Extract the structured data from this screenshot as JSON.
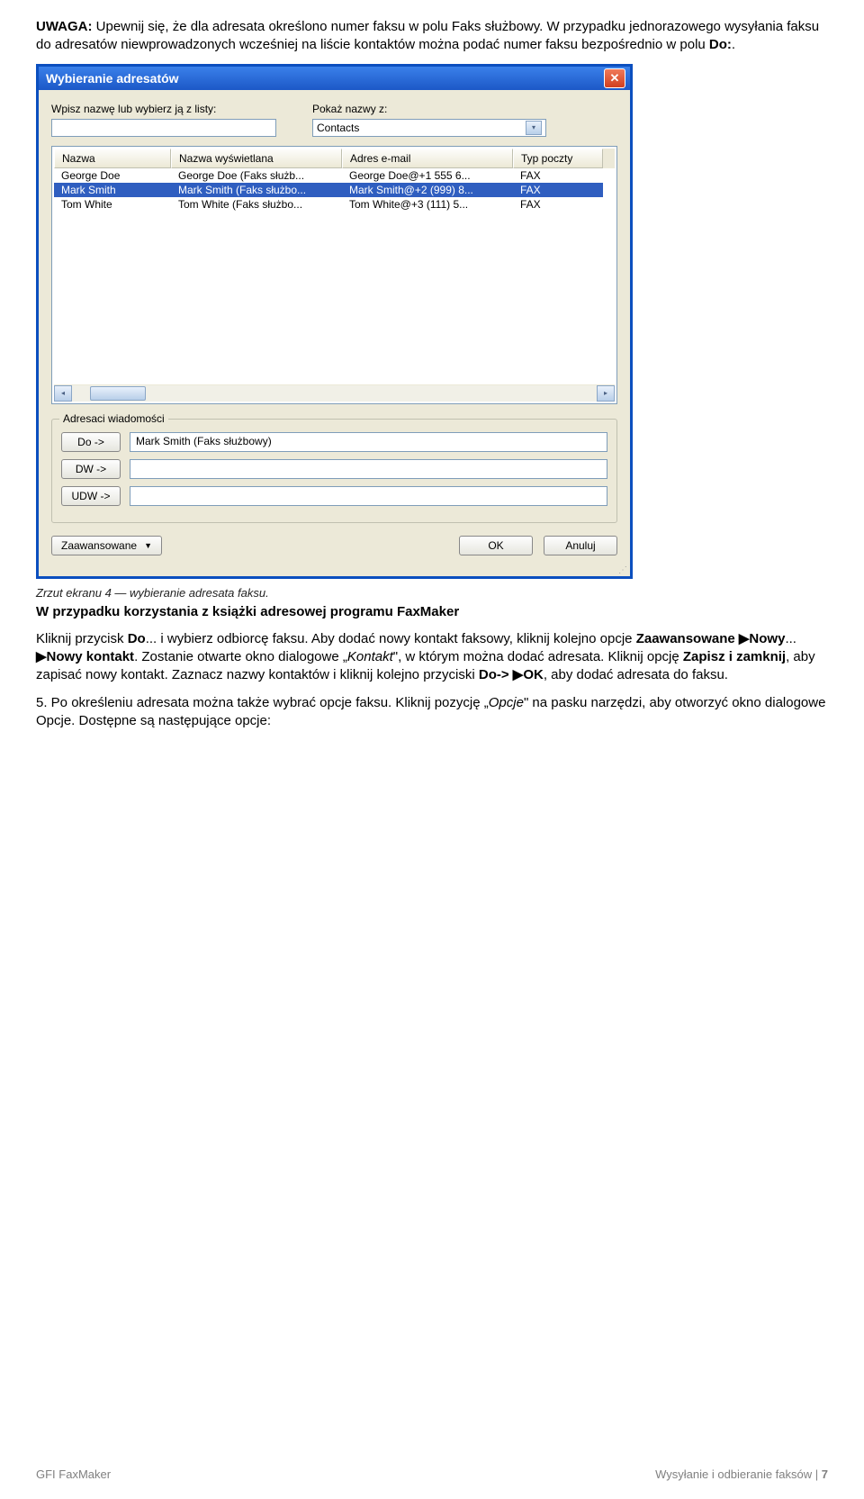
{
  "para1_prefix": "UWAGA:",
  "para1_body": " Upewnij się, że dla adresata określono numer faksu w polu Faks służbowy. W przypadku jednorazowego wysyłania faksu do adresatów niewprowadzonych wcześniej na liście kontaktów można podać numer faksu bezpośrednio w polu ",
  "para1_bold2": "Do:",
  "para1_tail": ".",
  "dialog": {
    "title": "Wybieranie adresatów",
    "label_name": "Wpisz nazwę lub wybierz ją z listy:",
    "label_show": "Pokaż nazwy z:",
    "combo_value": "Contacts",
    "columns": {
      "nazwa": "Nazwa",
      "wys": "Nazwa wyświetlana",
      "email": "Adres e-mail",
      "typ": "Typ poczty"
    },
    "rows": [
      {
        "nazwa": "George Doe",
        "wys": "George Doe (Faks służb...",
        "email": "George Doe@+1 555 6...",
        "typ": "FAX",
        "selected": false
      },
      {
        "nazwa": "Mark Smith",
        "wys": "Mark Smith (Faks służbo...",
        "email": "Mark Smith@+2 (999) 8...",
        "typ": "FAX",
        "selected": true
      },
      {
        "nazwa": "Tom White",
        "wys": "Tom White (Faks służbo...",
        "email": "Tom White@+3 (111) 5...",
        "typ": "FAX",
        "selected": false
      }
    ],
    "group_title": "Adresaci wiadomości",
    "btn_do": "Do ->",
    "btn_dw": "DW ->",
    "btn_udw": "UDW ->",
    "do_value": "Mark Smith (Faks służbowy)",
    "btn_adv": "Zaawansowane",
    "btn_ok": "OK",
    "btn_cancel": "Anuluj"
  },
  "caption": "Zrzut ekranu 4 — wybieranie adresata faksu.",
  "heading_subcase": "W przypadku korzystania z książki adresowej programu FaxMaker",
  "para2_a": "Kliknij przycisk ",
  "para2_b_do": "Do",
  "para2_b": "... i wybierz odbiorcę faksu. Aby dodać nowy kontakt faksowy, kliknij kolejno opcje ",
  "para2_b_nowy": "Zaawansowane ▶Nowy",
  "para2_c": "... ",
  "para2_b_kontakt": "▶Nowy kontakt",
  "para2_d": ". Zostanie otwarte okno dialogowe „",
  "para2_i_kontakt": "Kontakt",
  "para2_e": "\", w którym można dodać adresata. Kliknij opcję ",
  "para2_b_zapisz": "Zapisz i zamknij",
  "para2_f": ", aby zapisać nowy kontakt. Zaznacz nazwy kontaktów i kliknij kolejno przyciski ",
  "para2_b_dook": "Do-> ▶OK",
  "para2_g": ", aby dodać adresata do faksu.",
  "para3_a": "5. Po określeniu adresata można także wybrać opcje faksu. Kliknij pozycję „",
  "para3_i": "Opcje",
  "para3_b": "\" na pasku narzędzi, aby otworzyć okno dialogowe Opcje. Dostępne są następujące opcje:",
  "footer": {
    "left": "GFI FaxMaker",
    "right_text": "Wysyłanie i odbieranie faksów",
    "right_page": "7"
  }
}
